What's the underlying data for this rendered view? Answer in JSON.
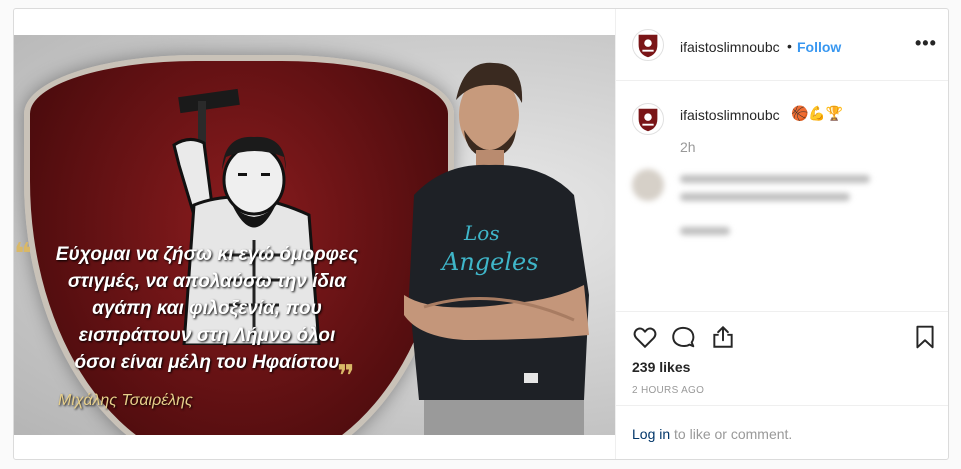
{
  "post": {
    "username": "ifaistoslimnoubc",
    "follow_label": "Follow",
    "separator": "•",
    "more_label": "•••",
    "caption_emojis": "🏀💪🏆",
    "caption_time": "2h",
    "likes": "239 likes",
    "time_ago": "2 HOURS AGO",
    "login_link": "Log in",
    "login_text": " to like or comment."
  },
  "image": {
    "quote_lines": [
      "Εύχομαι να ζήσω κι εγώ όμορφες",
      "στιγμές, να απολαύσω την ίδια",
      "αγάπη και φιλοξενία, που",
      "εισπράττουν στη Λήμνο όλοι",
      "όσοι είναι μέλη του Ηφαίστου"
    ],
    "quote_open": "❝",
    "quote_close": "❞",
    "author": "Μιχάλης Τσαιρέλης",
    "shirt_text": "Los Angeles"
  },
  "icons": {
    "heart": "heart-icon",
    "comment": "comment-icon",
    "share": "share-icon",
    "save": "bookmark-icon"
  },
  "colors": {
    "accent": "#3897f0",
    "link": "#003569",
    "muted": "#999999",
    "brand_red": "#7a1517"
  }
}
